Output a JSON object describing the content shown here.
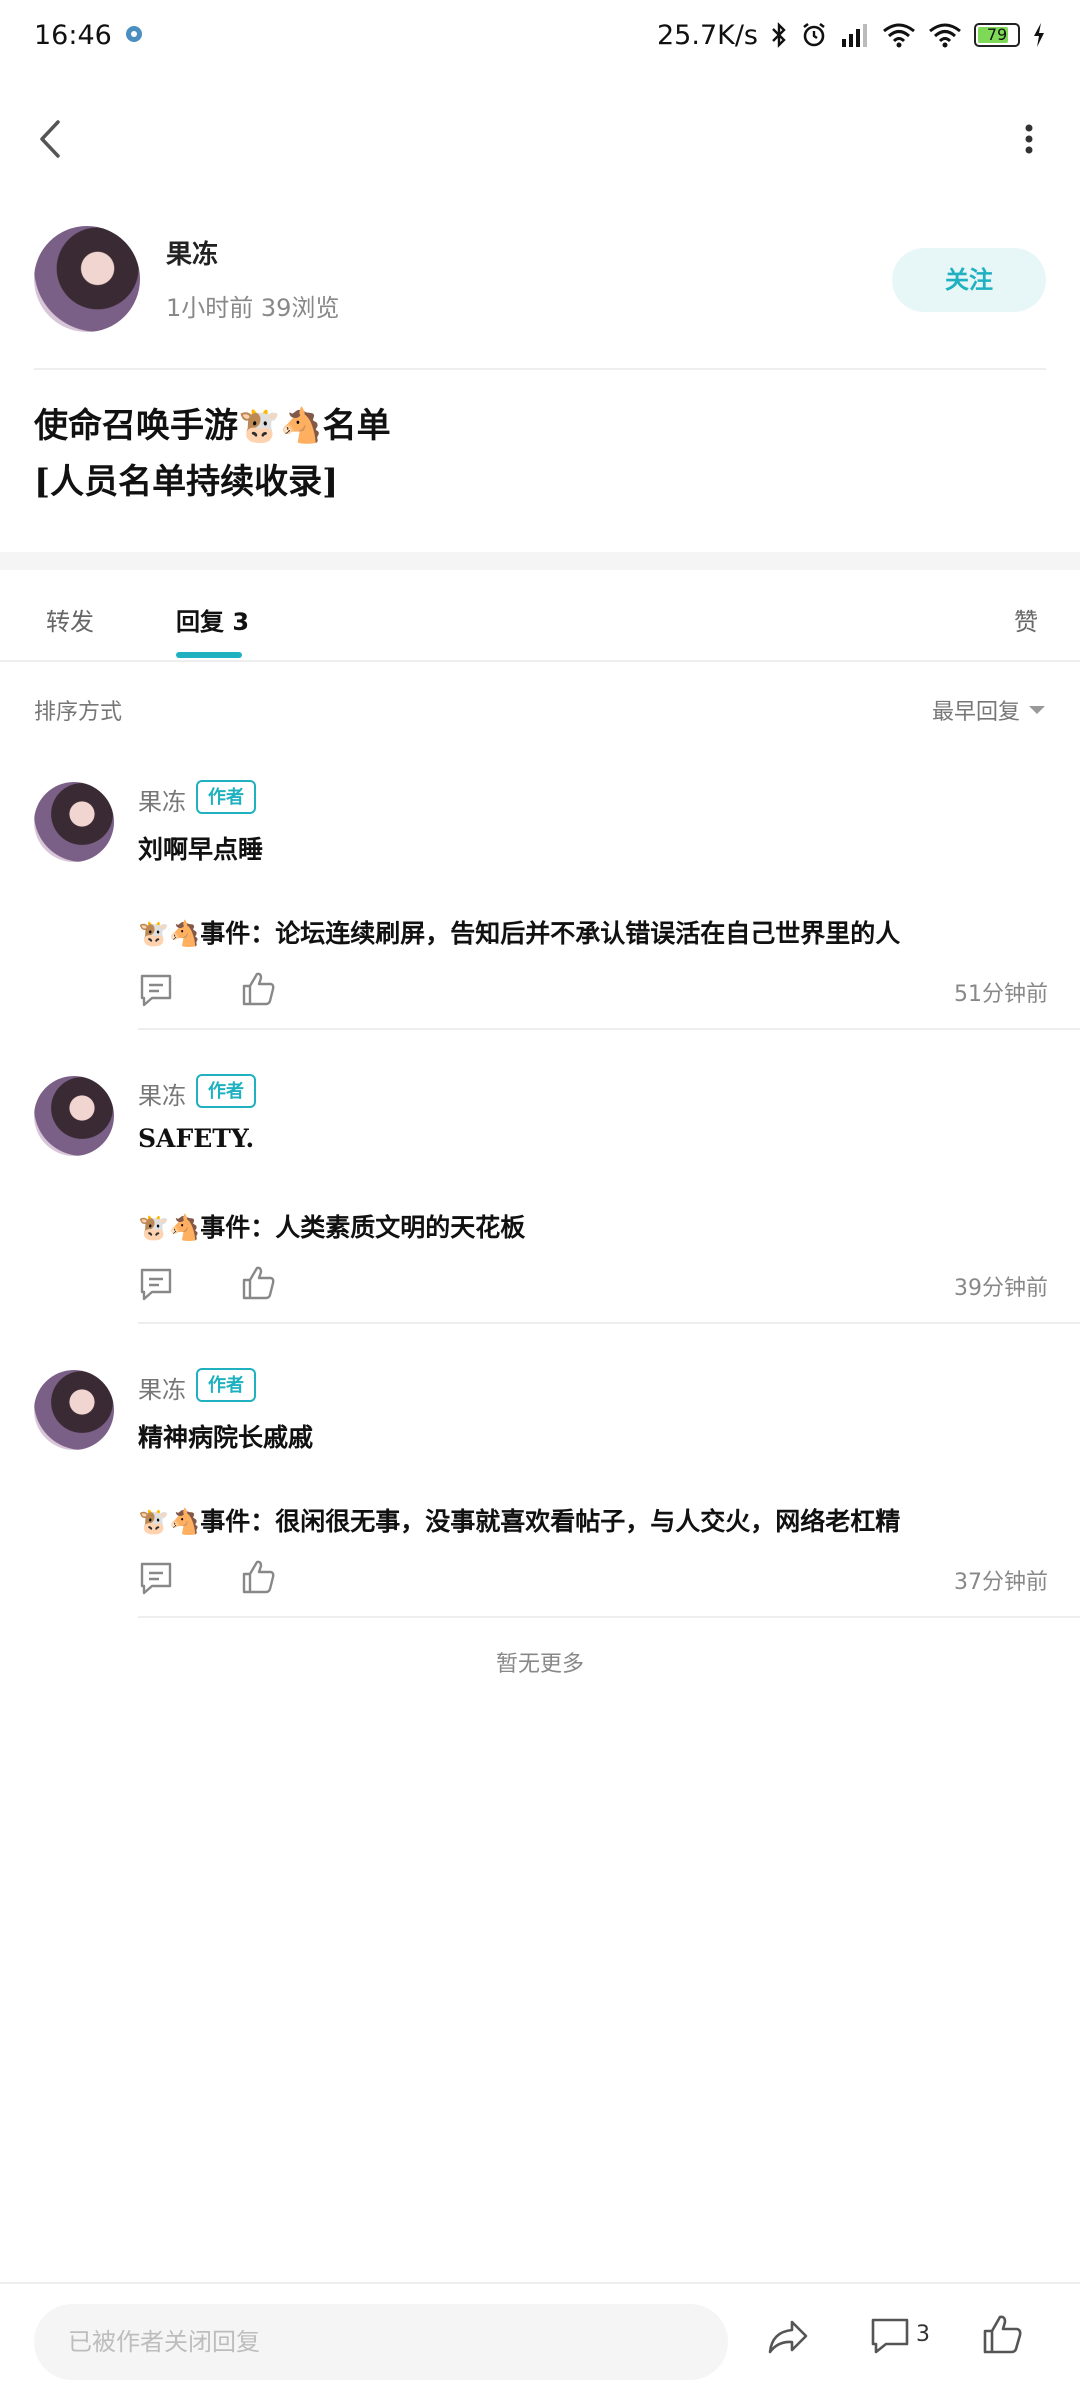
{
  "status": {
    "time": "16:46",
    "net_speed": "25.7K/s",
    "battery": "79"
  },
  "author": {
    "name": "果冻",
    "meta": "1小时前 39浏览",
    "follow_label": "关注"
  },
  "post": {
    "title_line1_a": "使命召唤手游",
    "title_line1_emoji": "🐮🐴",
    "title_line1_b": "名单",
    "title_line2": "[人员名单持续收录]"
  },
  "tabs": [
    {
      "label": "转发"
    },
    {
      "label": "回复 3"
    },
    {
      "label": "赞"
    }
  ],
  "sort": {
    "label": "排序方式",
    "value": "最早回复"
  },
  "comments": [
    {
      "name": "果冻",
      "badge": "作者",
      "text": "刘啊早点睡",
      "event": "🐮🐴事件：论坛连续刷屏，告知后并不承认错误活在自己世界里的人",
      "time": "51分钟前"
    },
    {
      "name": "果冻",
      "badge": "作者",
      "text": "SAFETY.",
      "event": "🐮🐴事件：人类素质文明的天花板",
      "time": "39分钟前"
    },
    {
      "name": "果冻",
      "badge": "作者",
      "text": "精神病院长戚戚",
      "event": "🐮🐴事件：很闲很无事，没事就喜欢看帖子，与人交火，网络老杠精",
      "time": "37分钟前"
    }
  ],
  "no_more": "暂无更多",
  "bottom": {
    "reply_placeholder": "已被作者关闭回复",
    "comment_count": "3"
  },
  "colors": {
    "accent": "#1fb1c0",
    "follow_bg": "#e7f7f8"
  }
}
